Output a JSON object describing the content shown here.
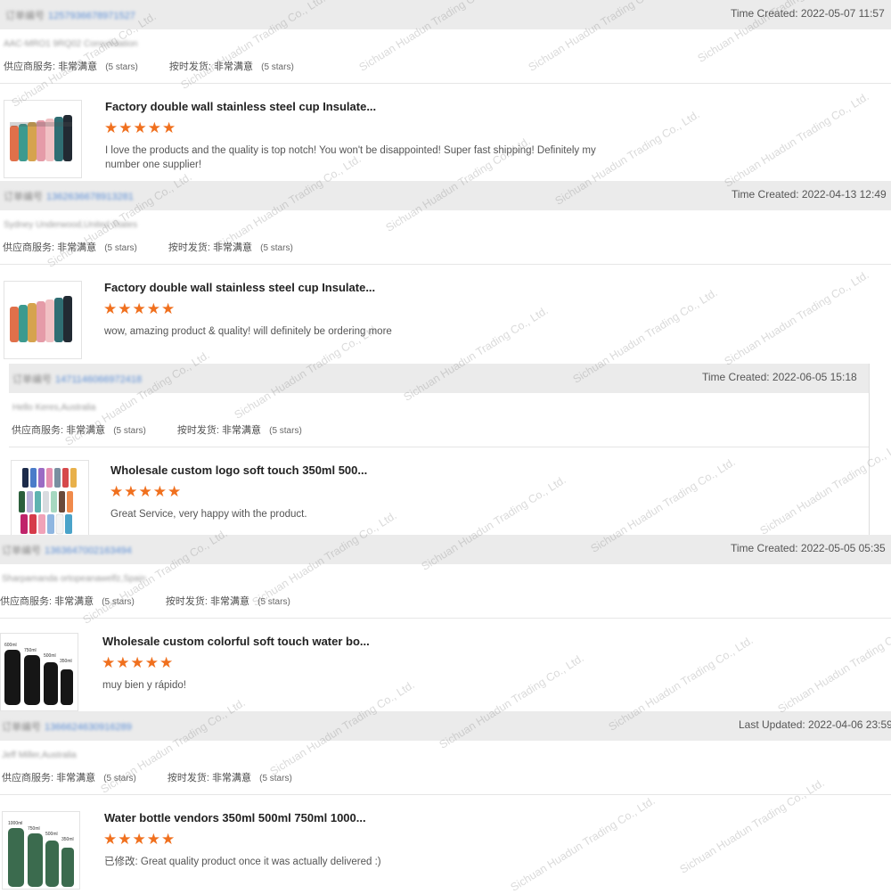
{
  "reviews": [
    {
      "order_label": "订单编号",
      "order_number": "1257936678971527",
      "time_text": "Time Created: 2022-05-07 11:57",
      "buyer": "AAC-MRO1 9RQ02 Consolidation",
      "rating1_label": "供应商服务:",
      "rating1_value": "非常满意",
      "rating1_stars": "(5 stars)",
      "rating2_label": "按时发货:",
      "rating2_value": "非常满意",
      "rating2_stars": "(5 stars)",
      "product_title": "Factory double wall stainless steel cup Insulate...",
      "stars": "★★★★★",
      "review_text": "I love the products and the quality is top notch! You won't be disappointed! Super fast shipping! Definitely my number one supplier!"
    },
    {
      "order_label": "订单编号",
      "order_number": "1362636678913281",
      "time_text": "Time Created: 2022-04-13 12:49",
      "buyer": "Sydney Underwood,United States",
      "rating1_label": "供应商服务:",
      "rating1_value": "非常满意",
      "rating1_stars": "(5 stars)",
      "rating2_label": "按时发货:",
      "rating2_value": "非常满意",
      "rating2_stars": "(5 stars)",
      "product_title": "Factory double wall stainless steel cup Insulate...",
      "stars": "★★★★★",
      "review_text": "wow, amazing product & quality! will definitely be ordering more"
    },
    {
      "order_label": "订单编号",
      "order_number": "1471146066972418",
      "time_text": "Time Created: 2022-06-05 15:18",
      "buyer": "Hello Keres,Australia",
      "rating1_label": "供应商服务:",
      "rating1_value": "非常满意",
      "rating1_stars": "(5 stars)",
      "rating2_label": "按时发货:",
      "rating2_value": "非常满意",
      "rating2_stars": "(5 stars)",
      "product_title": "Wholesale custom logo soft touch 350ml 500...",
      "stars": "★★★★★",
      "review_text": "Great Service, very happy with the product."
    },
    {
      "order_label": "订单编号",
      "order_number": "1363647002163494",
      "time_text": "Time Created: 2022-05-05 05:35",
      "buyer": "Sharpamanda ortopeanawelfz,Spain",
      "rating1_label": "供应商服务:",
      "rating1_value": "非常满意",
      "rating1_stars": "(5 stars)",
      "rating2_label": "按时发货:",
      "rating2_value": "非常满意",
      "rating2_stars": "(5 stars)",
      "product_title": "Wholesale custom colorful soft touch water bo...",
      "stars": "★★★★★",
      "review_text": "muy bien y rápido!"
    },
    {
      "order_label": "订单编号",
      "order_number": "1366624630916289",
      "time_text": "Last Updated: 2022-04-06 23:59",
      "buyer": "Jeff Miller,Australia",
      "rating1_label": "供应商服务:",
      "rating1_value": "非常满意",
      "rating1_stars": "(5 stars)",
      "rating2_label": "按时发货:",
      "rating2_value": "非常满意",
      "rating2_stars": "(5 stars)",
      "product_title": "Water bottle vendors 350ml 500ml 750ml 1000...",
      "stars": "★★★★★",
      "review_text": "已修改: Great quality product once it was actually delivered :)"
    }
  ],
  "watermark": "Sichuan Huadun Trading Co., Ltd.",
  "colors": {
    "star": "#f0701e",
    "header_bg": "#ebebeb",
    "order_link": "#5b8ed6"
  },
  "bottle_labels": {
    "black": [
      "600ml",
      "750ml",
      "500ml",
      "350ml"
    ],
    "green": [
      "1000ml",
      "750ml",
      "500ml",
      "350ml"
    ]
  }
}
